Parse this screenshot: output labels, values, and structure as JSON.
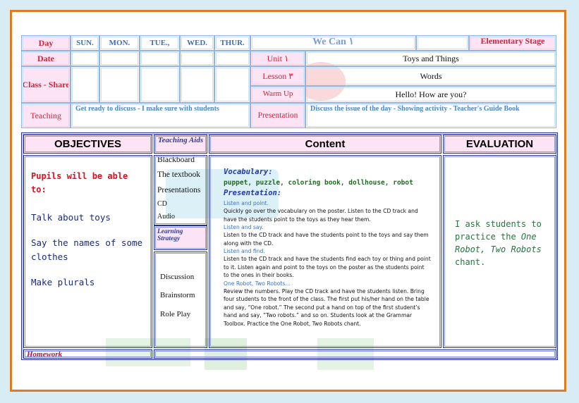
{
  "header": {
    "day_label": "Day",
    "days": [
      "SUN.",
      "MON.",
      "TUE.,",
      "WED.",
      "THUR."
    ],
    "we_can": "We Can ١",
    "stage": "Elementary Stage",
    "date_label": "Date",
    "class_label": "Class - Share",
    "teaching_label": "Teaching",
    "teaching_text": "Get ready to discuss - I make sure with students",
    "unit_label": "Unit ١",
    "unit_value": "Toys and Things",
    "lesson_label": "Lesson ٣",
    "lesson_value": "Words",
    "warmup_label": "Warm Up",
    "warmup_value": "Hello! How are you?",
    "presentation_label": "Presentation",
    "presentation_text": "Discuss the issue of the day - Showing activity - Teacher's Guide Book"
  },
  "table": {
    "objectives_head": "OBJECTIVES",
    "aids_head": "Teaching Aids",
    "content_head": "Content",
    "evaluation_head": "EVALUATION",
    "objectives_intro": "Pupils will be able to:",
    "objectives": [
      "Talk about toys",
      "Say the names of some clothes",
      "Make plurals"
    ],
    "aids": [
      "Blackboard",
      "The textbook",
      "Presentations",
      "CD",
      "Audio"
    ],
    "learning_strategy": "Learning Strategy",
    "strategies": [
      "Discussion",
      "Brainstorm",
      "Role Play"
    ],
    "homework": "Homework"
  },
  "content": {
    "vocab_head": "Vocabulary:",
    "vocab_words": "puppet, puzzle, coloring book, dollhouse, robot",
    "pres_head": "Presentation:",
    "s1_title": "Listen and point.",
    "s1_body": "Quickly go over the vocabulary on the poster. Listen to the CD track and have the students point to the toys as they hear them.",
    "s2_title": "Listen and say.",
    "s2_body": "Listen to the CD track and have the students point to the toys and say them along with the CD.",
    "s3_title": "Listen and find.",
    "s3_body": "Listen to the CD track and have the students find each toy or thing and point to it. Listen again and point to the toys on the poster as the students point to the ones in their books.",
    "s4_title": "One Robot, Two Robots…",
    "s4_body": "Review the numbers. Play the CD track and have the students listen. Bring four students to the front of the class. The first put his/her hand on the table and say, “One robot.” The second put a hand on top of the first student’s hand and say, “Two robots.” and so on. Students look at the Grammar Toolbox. Practice the One Robot, Two Robots chant."
  },
  "evaluation": {
    "pre": "I ask students to practice the ",
    "italic": "One Robot, Two Robots",
    "post": " chant."
  }
}
